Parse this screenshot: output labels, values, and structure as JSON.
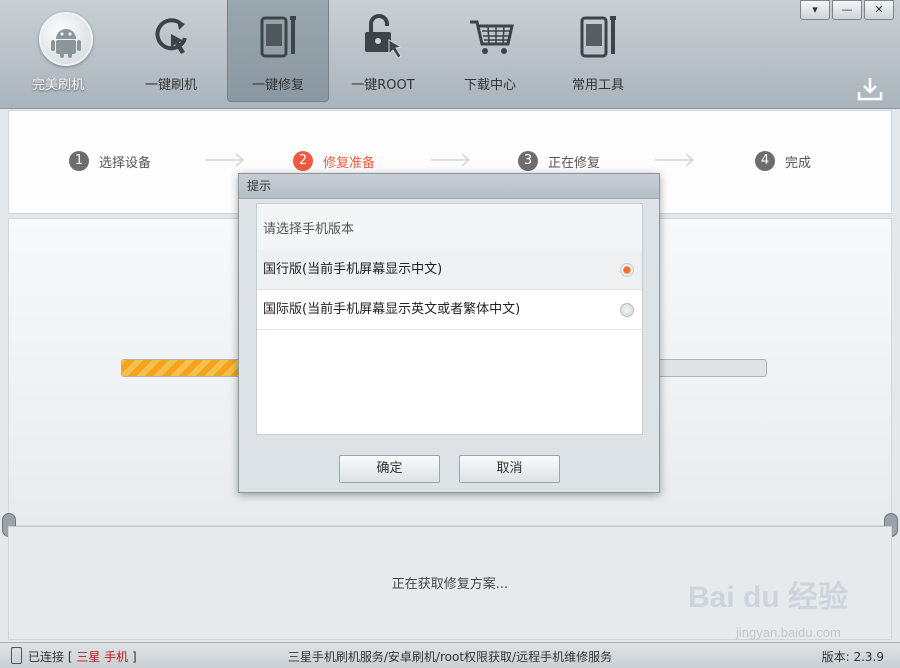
{
  "window": {
    "menu_glyph": "▾",
    "minimize_glyph": "—",
    "close_glyph": "✕"
  },
  "nav": {
    "items": [
      {
        "label": "完美刷机",
        "icon": "android-logo-icon"
      },
      {
        "label": "一键刷机",
        "icon": "refresh-touch-icon"
      },
      {
        "label": "一键修复",
        "icon": "phone-wrench-icon"
      },
      {
        "label": "一键ROOT",
        "icon": "unlock-touch-icon"
      },
      {
        "label": "下载中心",
        "icon": "shopping-cart-icon"
      },
      {
        "label": "常用工具",
        "icon": "tools-icon"
      }
    ],
    "active_index": 2
  },
  "steps": [
    {
      "num": "1",
      "label": "选择设备"
    },
    {
      "num": "2",
      "label": "修复准备"
    },
    {
      "num": "3",
      "label": "正在修复"
    },
    {
      "num": "4",
      "label": "完成"
    }
  ],
  "active_step": 1,
  "progress": {
    "fraction": 0.18
  },
  "status_text": "正在获取修复方案...",
  "dialog": {
    "title": "提示",
    "prompt": "请选择手机版本",
    "options": [
      {
        "label": "国行版(当前手机屏幕显示中文)",
        "selected": true
      },
      {
        "label": "国际版(当前手机屏幕显示英文或者繁体中文)",
        "selected": false
      }
    ],
    "ok_label": "确定",
    "cancel_label": "取消"
  },
  "footer": {
    "connection_prefix": "已连接 [",
    "device": "三星 手机",
    "connection_suffix": "]",
    "service": "三星手机刷机服务/安卓刷机/root权限获取/远程手机维修服务",
    "version": "版本: 2.3.9"
  },
  "watermark": {
    "main": "Bai du 经验",
    "sub": "jingyan.baidu.com"
  },
  "colors": {
    "accent": "#f05a3e",
    "progress": "#f7a21b",
    "brand_red": "#c0141b"
  }
}
